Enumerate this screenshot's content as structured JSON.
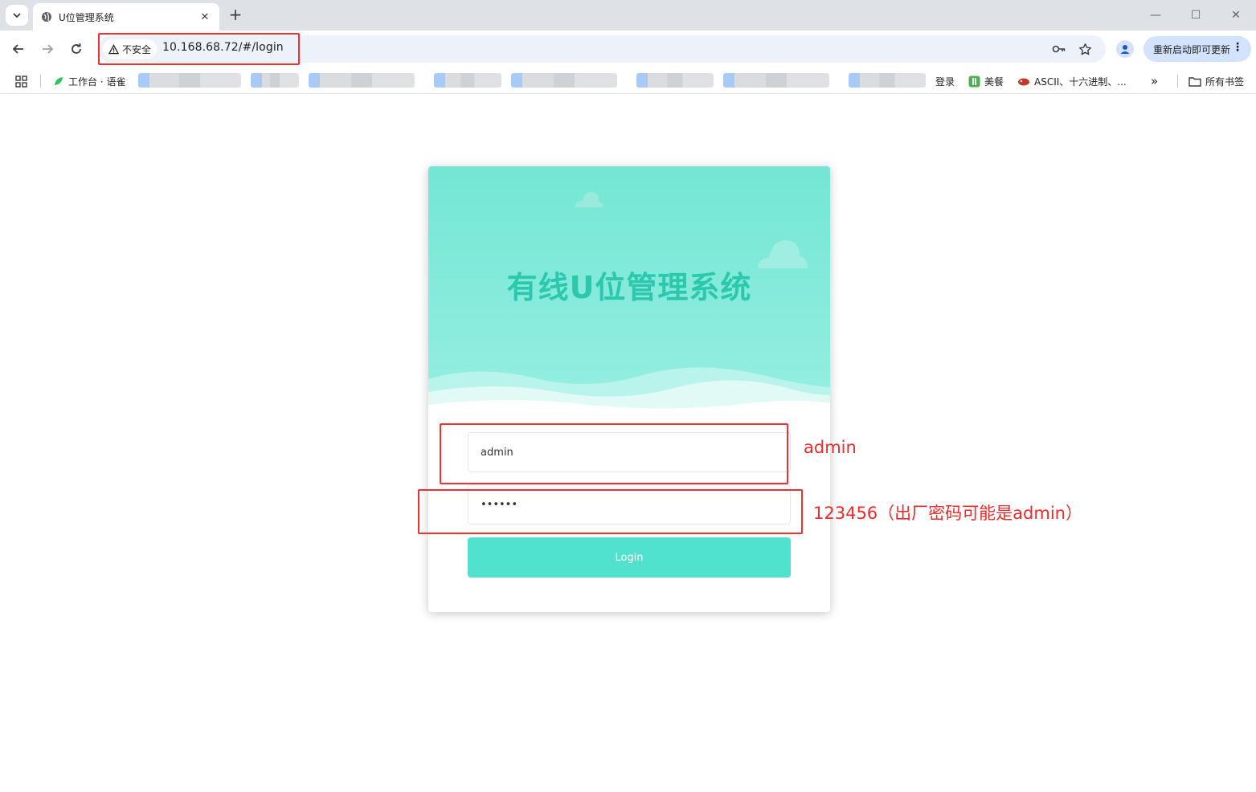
{
  "browser": {
    "tab": {
      "title": "U位管理系统"
    },
    "address_bar": {
      "security_label": "不安全",
      "url": "10.168.68.72/#/login"
    },
    "update_button": {
      "label": "重新启动即可更新"
    },
    "bookmarks": [
      {
        "label": "工作台 · 语雀"
      },
      {
        "label": "登录"
      },
      {
        "label": "美餐"
      },
      {
        "label": "ASCII、十六进制、..."
      },
      {
        "label": "所有书签"
      }
    ]
  },
  "login": {
    "title": "有线U位管理系统",
    "username": {
      "value": "admin"
    },
    "password": {
      "value": "123456"
    },
    "submit_label": "Login"
  },
  "annotations": {
    "username_note": "admin",
    "password_note": "123456（出厂密码可能是admin）"
  },
  "colors": {
    "accent": "#51e1cf",
    "title_text": "#2cc8ad",
    "annotation_red": "#ee3030"
  }
}
